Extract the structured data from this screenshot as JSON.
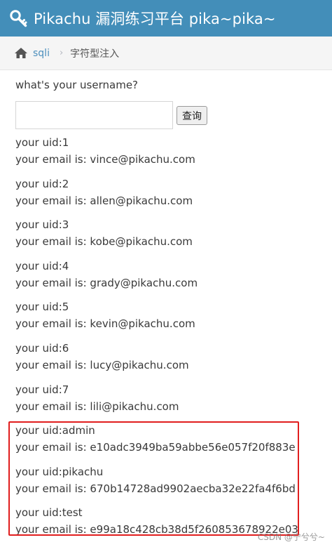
{
  "header": {
    "title": "Pikachu 漏洞练习平台 pika~pika~",
    "icon": "key-icon",
    "color": "#438eb9"
  },
  "breadcrumb": {
    "home_icon": "home-icon",
    "link": "sqli",
    "separator": "›",
    "current": "字符型注入"
  },
  "form": {
    "question": "what's your username?",
    "input_value": "",
    "button_label": "查询"
  },
  "results": [
    {
      "uid": "your uid:1",
      "email": "your email is: vince@pikachu.com"
    },
    {
      "uid": "your uid:2",
      "email": "your email is: allen@pikachu.com"
    },
    {
      "uid": "your uid:3",
      "email": "your email is: kobe@pikachu.com"
    },
    {
      "uid": "your uid:4",
      "email": "your email is: grady@pikachu.com"
    },
    {
      "uid": "your uid:5",
      "email": "your email is: kevin@pikachu.com"
    },
    {
      "uid": "your uid:6",
      "email": "your email is: lucy@pikachu.com"
    },
    {
      "uid": "your uid:7",
      "email": "your email is: lili@pikachu.com"
    },
    {
      "uid": "your uid:admin",
      "email": "your email is: e10adc3949ba59abbe56e057f20f883e"
    },
    {
      "uid": "your uid:pikachu",
      "email": "your email is: 670b14728ad9902aecba32e22fa4f6bd"
    },
    {
      "uid": "your uid:test",
      "email": "your email is: e99a18c428cb38d5f260853678922e03"
    }
  ],
  "highlight_color": "#e11e1e",
  "watermark": "CSDN @宁兮兮~"
}
